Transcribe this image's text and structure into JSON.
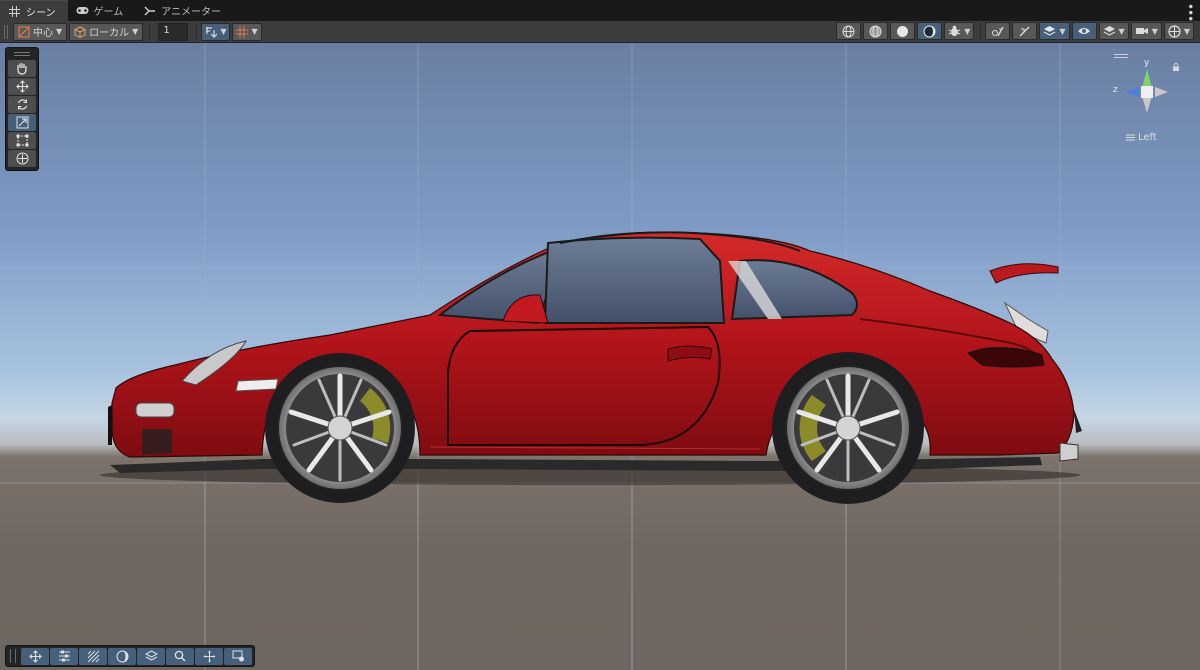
{
  "tabs": [
    {
      "label": "シーン",
      "icon": "grid-icon",
      "active": true
    },
    {
      "label": "ゲーム",
      "icon": "gamepad-icon",
      "active": false
    },
    {
      "label": "アニメーター",
      "icon": "animator-icon",
      "active": false
    }
  ],
  "toolbar": {
    "pivot_label": "中心",
    "space_label": "ローカル",
    "increment_value": "1"
  },
  "gizmo": {
    "y_label": "y",
    "z_label": "z",
    "view_label": "Left"
  },
  "colors": {
    "accent": "#46607c",
    "car_body": "#b1141a",
    "gizmo_y": "#7fd36a",
    "gizmo_z": "#4a7fe0"
  }
}
